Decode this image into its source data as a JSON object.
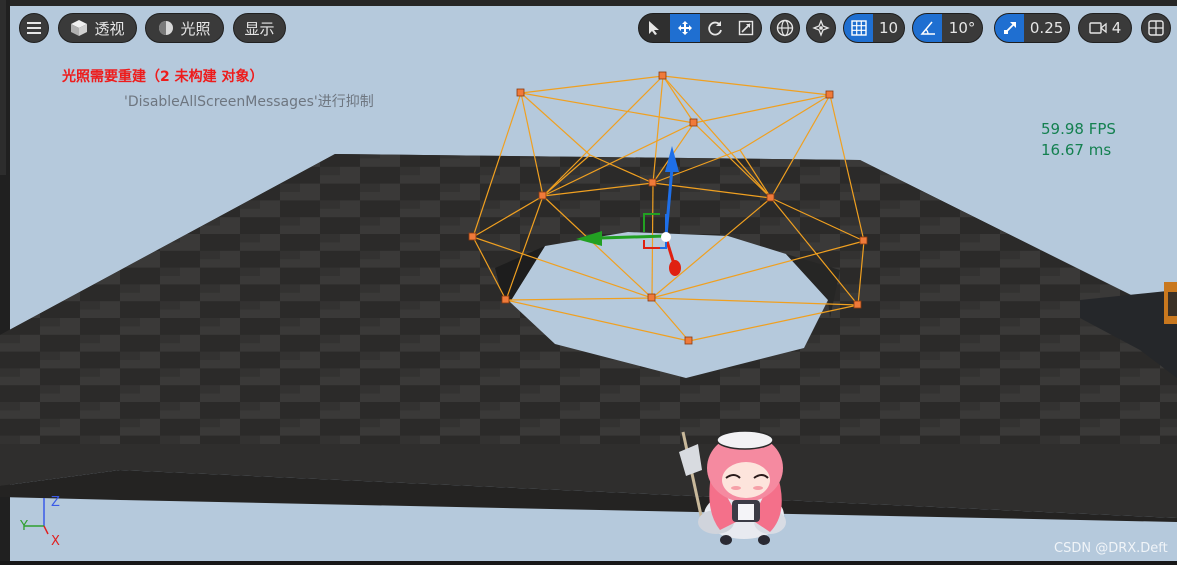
{
  "toolbar": {
    "menu_icon": "hamburger-icon",
    "view_mode": {
      "label": "透视",
      "icon": "cube-icon"
    },
    "lighting": {
      "label": "光照",
      "icon": "sphere-icon"
    },
    "show": {
      "label": "显示"
    },
    "transform_tools": [
      "select-icon",
      "translate-icon",
      "rotate-icon",
      "scale-icon"
    ],
    "active_tool": "translate",
    "world_space_icon": "globe-icon",
    "surface_snap_icon": "surface-snap-icon",
    "grid_snap": {
      "icon": "grid-icon",
      "value": "10"
    },
    "rotation_snap": {
      "icon": "angle-icon",
      "value": "10°"
    },
    "scale_snap": {
      "icon": "scale-snap-icon",
      "value": "0.25"
    },
    "camera_speed": {
      "icon": "camera-icon",
      "value": "4"
    },
    "layout_icon": "viewport-layout-icon"
  },
  "messages": {
    "lighting_rebuild": "光照需要重建（2 未构建 对象）",
    "suppress_hint": "'DisableAllScreenMessages'进行抑制"
  },
  "stats": {
    "fps": "59.98 FPS",
    "frame_time": "16.67 ms"
  },
  "axes": {
    "z": "Z",
    "y": "Y",
    "x": "X"
  },
  "watermark": "CSDN @DRX.Deft",
  "colors": {
    "active_blue": "#1f6fd1",
    "warning_red": "#ee1c1c",
    "stat_green": "#148050",
    "wireframe_orange": "#f0a020",
    "vertex_orange": "#f07a3a",
    "sky": "#b5c9dc",
    "floor_dark": "#2c2b2a",
    "floor_light": "#3a3938"
  }
}
